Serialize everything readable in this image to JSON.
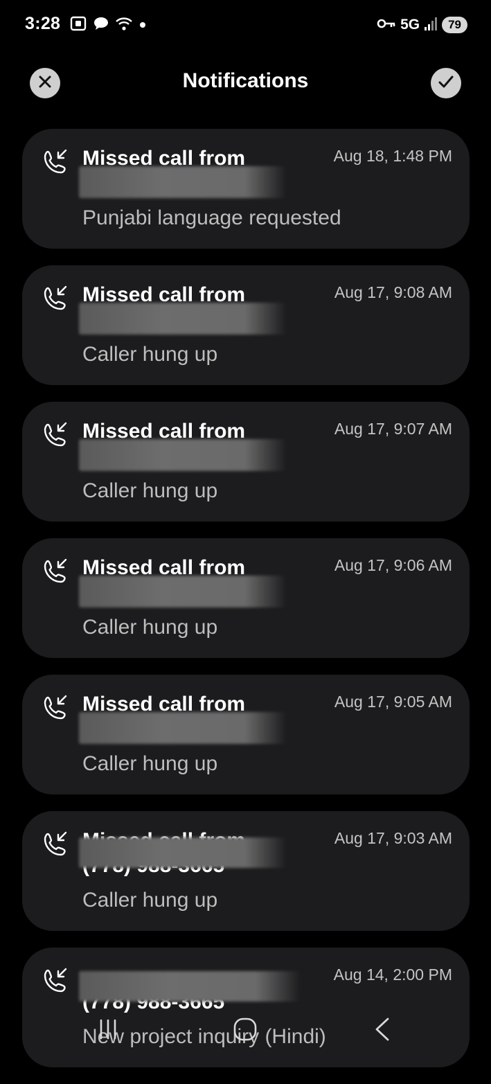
{
  "status": {
    "time": "3:28",
    "network": "5G",
    "battery": "79"
  },
  "header": {
    "title": "Notifications"
  },
  "notifications": [
    {
      "title": "Missed call from",
      "phone": "",
      "time": "Aug 18, 1:48 PM",
      "subtitle": "Punjabi language requested"
    },
    {
      "title": "Missed call from",
      "phone": "",
      "time": "Aug 17, 9:08 AM",
      "subtitle": "Caller hung up"
    },
    {
      "title": "Missed call from",
      "phone": "",
      "time": "Aug 17, 9:07 AM",
      "subtitle": "Caller hung up"
    },
    {
      "title": "Missed call from",
      "phone": "",
      "time": "Aug 17, 9:06 AM",
      "subtitle": "Caller hung up"
    },
    {
      "title": "Missed call from",
      "phone": "",
      "time": "Aug 17, 9:05 AM",
      "subtitle": "Caller hung up"
    },
    {
      "title": "Missed call from",
      "phone": "(778) 988-3665",
      "time": "Aug 17, 9:03 AM",
      "subtitle": "Caller hung up"
    },
    {
      "title": "",
      "phone": "(778) 988-3665",
      "time": "Aug 14, 2:00 PM",
      "subtitle": "New project inquiry (Hindi)"
    }
  ],
  "icons": {
    "close": "close-icon",
    "done": "checkmark-icon",
    "call": "missed-call-icon",
    "nav_recents": "recents-icon",
    "nav_home": "home-icon",
    "nav_back": "back-icon"
  }
}
